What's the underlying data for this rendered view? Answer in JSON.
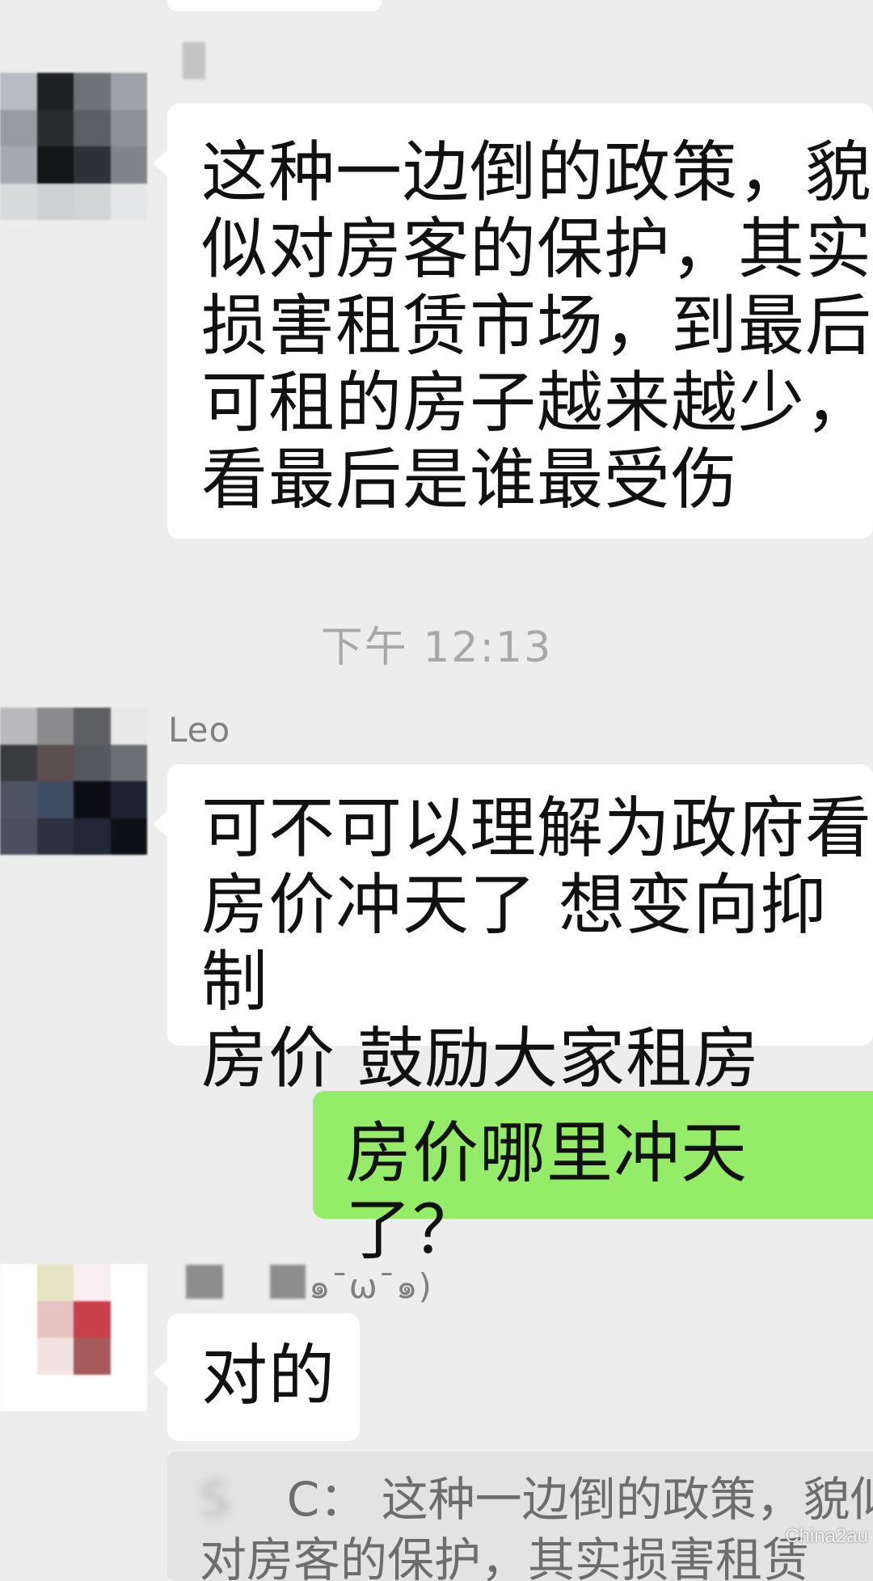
{
  "messages": [
    {
      "id": "m1",
      "direction": "incoming",
      "sender": "",
      "text_lines": [
        "这种一边倒的政策，貌",
        "似对房客的保护，其实",
        "损害租赁市场，到最后",
        "可租的房子越来越少，",
        "看最后是谁最受伤"
      ]
    },
    {
      "id": "m2",
      "direction": "incoming",
      "sender": "Leo",
      "text_lines": [
        "可不可以理解为政府看",
        "房价冲天了 想变向抑制",
        "房价 鼓励大家租房"
      ]
    },
    {
      "id": "m3",
      "direction": "outgoing",
      "text_lines": [
        "房价哪里冲天了？"
      ]
    },
    {
      "id": "m4",
      "direction": "incoming",
      "sender_suffix": "๑¯ω¯๑)",
      "text_lines": [
        "对的"
      ]
    }
  ],
  "timestamp": "下午 12:13",
  "quote": {
    "line1_sender_masked": "S",
    "line1_sender_tail": "C：",
    "line1_text": "这种一边倒的政策，貌似",
    "line2_text": "对房客的保护，其实损害租赁"
  },
  "watermark": "Chinа2au",
  "colors": {
    "background": "#ededed",
    "incoming_bubble": "#ffffff",
    "outgoing_bubble": "#95ec69",
    "timestamp": "#a8a8a8"
  }
}
